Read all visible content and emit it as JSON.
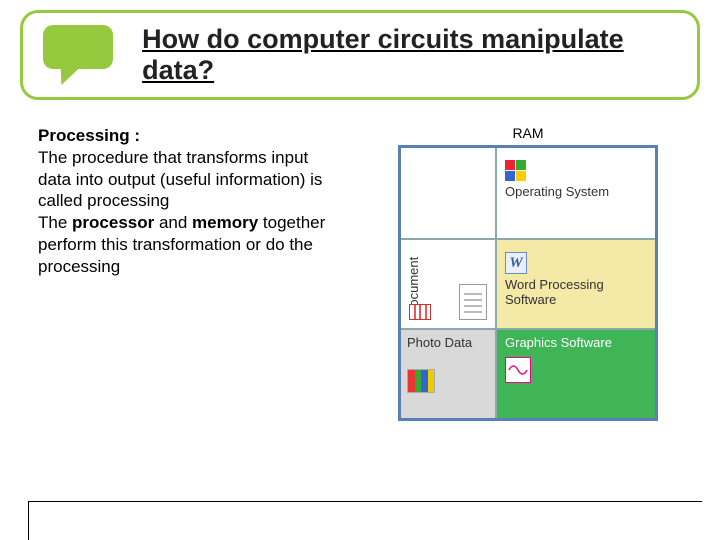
{
  "header": {
    "title": "How do computer circuits manipulate data?"
  },
  "text": {
    "heading": "Processing :",
    "p1a": "The procedure that transforms input data into output (useful information) is called processing",
    "p2a": "The ",
    "p2b": "processor",
    "p2c": " and ",
    "p2d": "memory",
    "p2e": " together perform this transformation or do the processing"
  },
  "diagram": {
    "ram": "RAM",
    "cells": {
      "r1l": "",
      "r1r": "Operating System",
      "r2l": "Document",
      "r2r": "Word Processing Software",
      "r3l": "Photo Data",
      "r3r": "Graphics Software"
    }
  }
}
